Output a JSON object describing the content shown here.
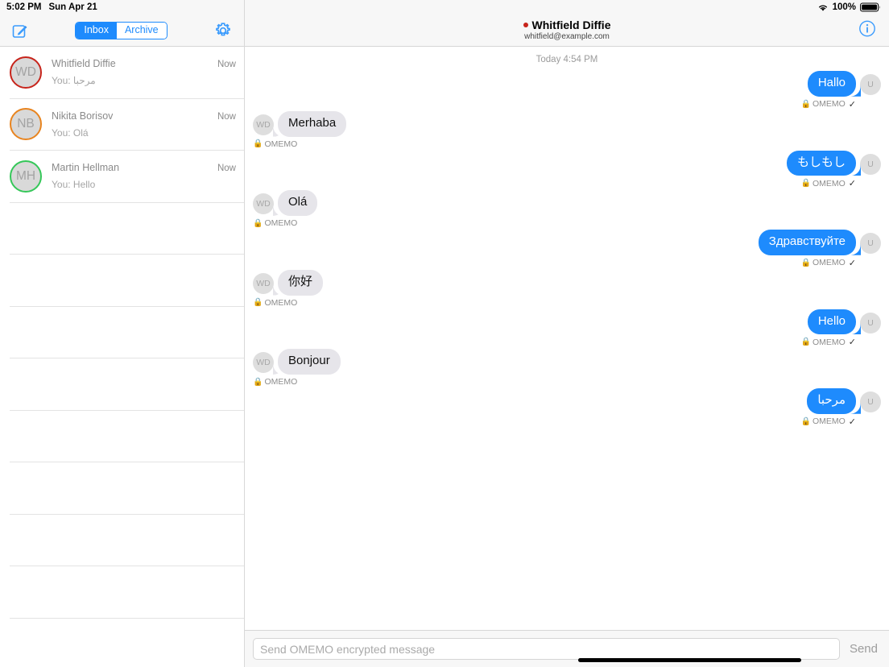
{
  "status_bar": {
    "time": "5:02 PM",
    "date": "Sun Apr 21",
    "battery_percent": "100%",
    "wifi_icon": "wifi-icon",
    "battery_icon": "battery-icon"
  },
  "sidebar": {
    "compose_icon": "compose-icon",
    "settings_icon": "gear-icon",
    "segmented": {
      "inbox_label": "Inbox",
      "archive_label": "Archive",
      "selected": "Inbox"
    },
    "conversations": [
      {
        "initials": "WD",
        "ring_color": "#c7241b",
        "name": "Whitfield Diffie",
        "time": "Now",
        "preview": "You: مرحبا"
      },
      {
        "initials": "NB",
        "ring_color": "#e8841f",
        "name": "Nikita Borisov",
        "time": "Now",
        "preview": "You: Olá"
      },
      {
        "initials": "MH",
        "ring_color": "#35c759",
        "name": "Martin Hellman",
        "time": "Now",
        "preview": "You: Hello"
      }
    ],
    "empty_row_count": 9
  },
  "chat": {
    "presence_dot_color": "#c7241b",
    "title": "Whitfield Diffie",
    "subtitle": "whitfield@example.com",
    "info_icon": "info-icon",
    "day_separator": "Today 4:54 PM",
    "encryption_label": "OMEMO",
    "lock_icon": "lock-icon",
    "check_icon": "checkmark-icon",
    "own_avatar_initials": "U",
    "peer_avatar_initials": "WD",
    "messages": [
      {
        "direction": "out",
        "text": "Hallo",
        "encryption": "OMEMO",
        "delivered": true
      },
      {
        "direction": "in",
        "text": "Merhaba",
        "encryption": "OMEMO",
        "delivered": false
      },
      {
        "direction": "out",
        "text": "もしもし",
        "encryption": "OMEMO",
        "delivered": true
      },
      {
        "direction": "in",
        "text": "Olá",
        "encryption": "OMEMO",
        "delivered": false
      },
      {
        "direction": "out",
        "text": "Здравствуйте",
        "encryption": "OMEMO",
        "delivered": true
      },
      {
        "direction": "in",
        "text": "你好",
        "encryption": "OMEMO",
        "delivered": false
      },
      {
        "direction": "out",
        "text": "Hello",
        "encryption": "OMEMO",
        "delivered": true
      },
      {
        "direction": "in",
        "text": "Bonjour",
        "encryption": "OMEMO",
        "delivered": false
      },
      {
        "direction": "out",
        "text": "مرحبا",
        "encryption": "OMEMO",
        "delivered": true
      }
    ]
  },
  "compose": {
    "placeholder": "Send OMEMO encrypted message",
    "value": "",
    "send_label": "Send"
  }
}
